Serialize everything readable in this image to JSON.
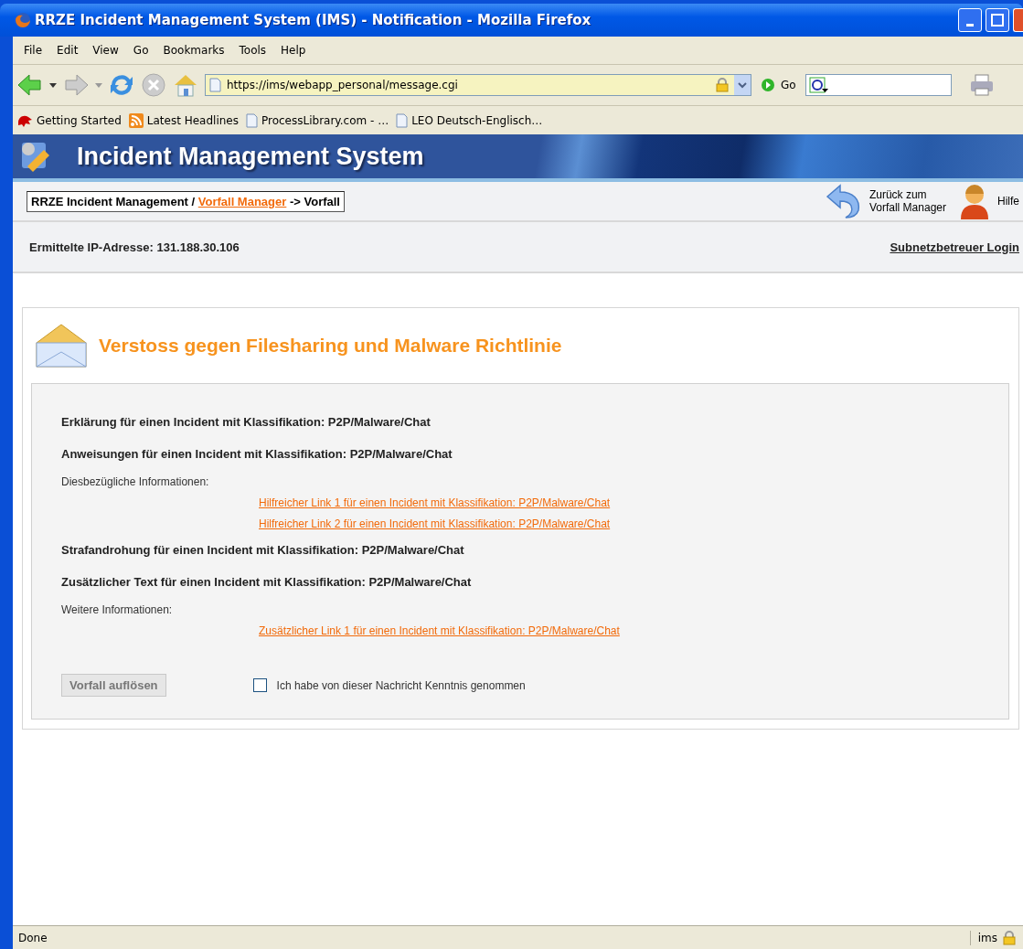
{
  "window": {
    "title": "RRZE Incident Management System (IMS) - Notification - Mozilla Firefox"
  },
  "menu": [
    "File",
    "Edit",
    "View",
    "Go",
    "Bookmarks",
    "Tools",
    "Help"
  ],
  "navigation": {
    "url": "https://ims/webapp_personal/message.cgi",
    "go": "Go"
  },
  "bookmarks": [
    {
      "label": "Getting Started",
      "kind": "start"
    },
    {
      "label": "Latest Headlines",
      "kind": "feed"
    },
    {
      "label": "ProcessLibrary.com - …",
      "kind": "page"
    },
    {
      "label": "LEO Deutsch-Englisch…",
      "kind": "page"
    }
  ],
  "header": {
    "title": "Incident Management System"
  },
  "breadcrumb": {
    "root": "RRZE Incident Management /",
    "link": "Vorfall Manager",
    "current": "-> Vorfall"
  },
  "actions": [
    {
      "label_lines": [
        "Zurück zum",
        "Vorfall Manager"
      ],
      "kind": "back"
    },
    {
      "label_lines": [
        "Hilfe"
      ],
      "kind": "help"
    }
  ],
  "ip_line": "Ermittelte IP-Adresse: 131.188.30.106",
  "login_link": "Subnetzbetreuer Login",
  "message": {
    "title": "Verstoss gegen Filesharing und Malware Richtlinie",
    "blocks": [
      {
        "kind": "heading",
        "text": "Erklärung für einen Incident mit Klassifikation: P2P/Malware/Chat"
      },
      {
        "kind": "heading",
        "text": "Anweisungen für einen Incident mit Klassifikation: P2P/Malware/Chat"
      },
      {
        "kind": "label",
        "text": "Diesbezügliche Informationen:"
      },
      {
        "kind": "link",
        "text": "Hilfreicher Link 1 für einen Incident mit Klassifikation: P2P/Malware/Chat"
      },
      {
        "kind": "link",
        "text": "Hilfreicher Link 2 für einen Incident mit Klassifikation: P2P/Malware/Chat"
      },
      {
        "kind": "heading",
        "text": "Strafandrohung für einen Incident mit Klassifikation: P2P/Malware/Chat"
      },
      {
        "kind": "heading",
        "text": "Zusätzlicher Text für einen Incident mit Klassifikation: P2P/Malware/Chat"
      },
      {
        "kind": "label",
        "text": "Weitere Informationen:"
      },
      {
        "kind": "link",
        "text": "Zusätzlicher Link 1 für einen Incident mit Klassifikation: P2P/Malware/Chat"
      }
    ],
    "resolve_button": {
      "label": "Vorfall auflösen",
      "disabled": true
    },
    "acknowledge": {
      "label": "Ich habe von dieser Nachricht Kenntnis genommen",
      "checked": false
    }
  },
  "status_bar": {
    "text": "Done",
    "host": "ims"
  }
}
